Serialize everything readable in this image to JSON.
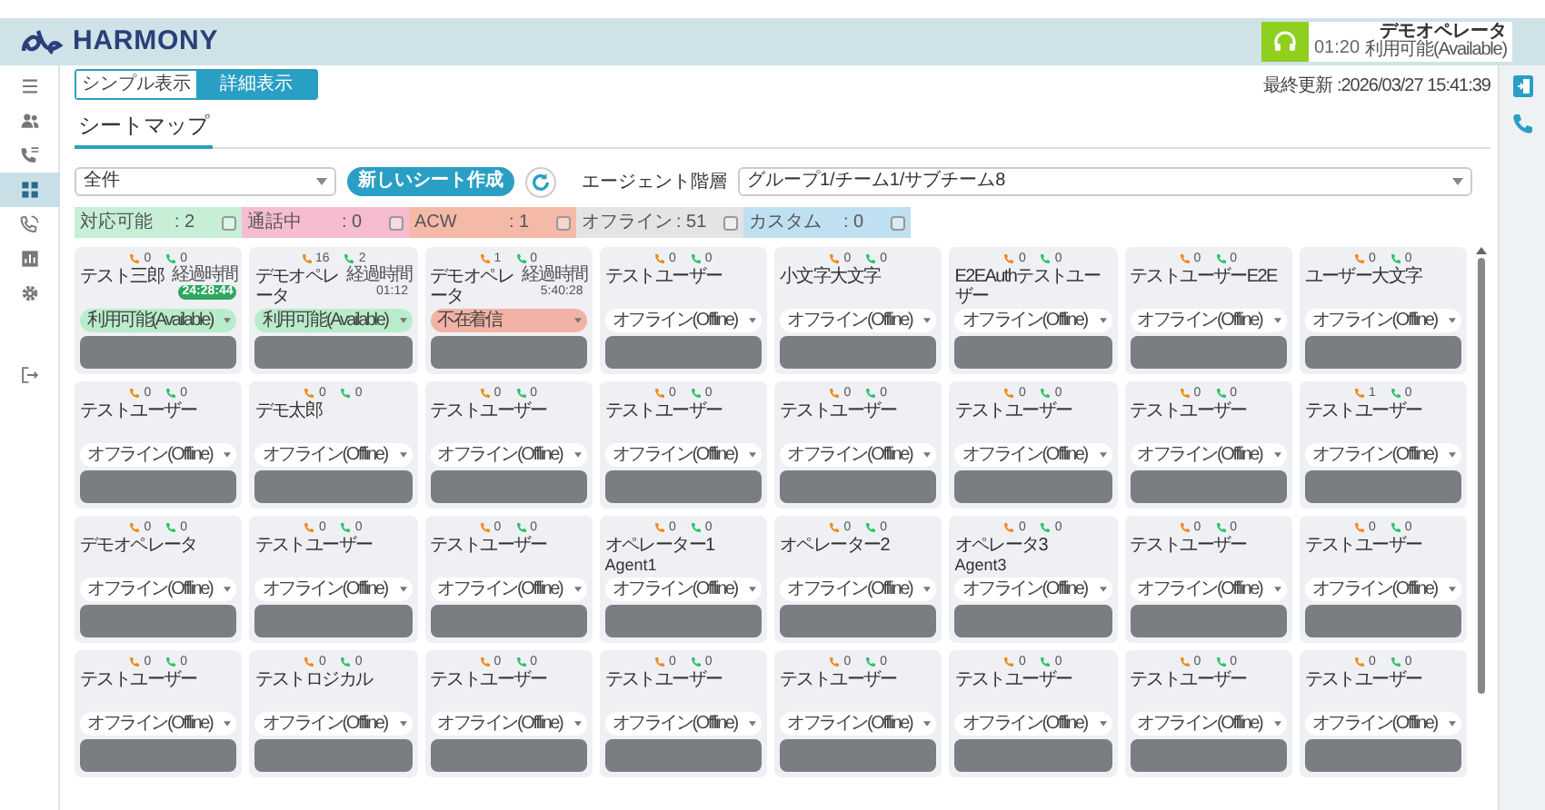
{
  "header": {
    "brand": "HARMONY",
    "agent": {
      "name": "デモオペレータ",
      "time": "01:20",
      "status": "利用可能(Available)"
    }
  },
  "sidebar": {
    "items": [
      {
        "kind": "menu",
        "selected": false
      },
      {
        "kind": "people",
        "selected": false
      },
      {
        "kind": "calls",
        "selected": false
      },
      {
        "kind": "grid",
        "selected": true
      },
      {
        "kind": "phone",
        "selected": false
      },
      {
        "kind": "chart",
        "selected": false
      },
      {
        "kind": "gear",
        "selected": false
      },
      {
        "kind": "logout",
        "selected": false
      }
    ]
  },
  "view_toggle": [
    {
      "label": "シンプル表示",
      "selected": false
    },
    {
      "label": "詳細表示",
      "selected": true
    }
  ],
  "last_updated": "最終更新 :2026/03/27 15:41:39",
  "title": "シートマップ",
  "toolbar": {
    "sheet_select": "全件",
    "create_button": "新しいシート作成",
    "hierarchy_label": "エージェント階層",
    "hierarchy_select": "グループ1/チーム1/サブチーム8"
  },
  "filters": [
    {
      "label": "対応可能",
      "count": ": 2",
      "color": "#c6efd6",
      "checked": false
    },
    {
      "label": "通話中",
      "count": ": 0",
      "color": "#f6bdd0",
      "checked": false
    },
    {
      "label": "ACW",
      "count": ": 1",
      "color": "#f5b9a8",
      "checked": false
    },
    {
      "label": "オフライン",
      "count": ": 51",
      "color": "#e4e4e4",
      "checked": false
    },
    {
      "label": "カスタム",
      "count": ": 0",
      "color": "#bfe0f0",
      "checked": false
    }
  ],
  "seats": [
    {
      "name": "テスト三郎",
      "incoming": "0",
      "outgoing": "0",
      "elapsed": {
        "label": "経過時間",
        "time": "24:28:44",
        "highlight": true
      },
      "status": "利用可能(Available)",
      "kind": "available"
    },
    {
      "name": "デモオペレータ",
      "incoming": "16",
      "outgoing": "2",
      "elapsed": {
        "label": "経過時間",
        "time": "01:12",
        "highlight": false
      },
      "status": "利用可能(Available)",
      "kind": "available"
    },
    {
      "name": "デモオペレータ",
      "incoming": "1",
      "outgoing": "0",
      "elapsed": {
        "label": "経過時間",
        "time": "5:40:28",
        "highlight": false
      },
      "status": "不在着信",
      "kind": "missed"
    },
    {
      "name": "テストユーザー",
      "incoming": "0",
      "outgoing": "0",
      "status": "オフライン(Offline)",
      "kind": "offline"
    },
    {
      "name": "小文字大文字",
      "incoming": "0",
      "outgoing": "0",
      "status": "オフライン(Offline)",
      "kind": "offline"
    },
    {
      "name": "E2EAuthテストユーザー",
      "incoming": "0",
      "outgoing": "0",
      "status": "オフライン(Offline)",
      "kind": "offline"
    },
    {
      "name": "テストユーザーE2E",
      "incoming": "0",
      "outgoing": "0",
      "status": "オフライン(Offline)",
      "kind": "offline"
    },
    {
      "name": "ユーザー大文字",
      "incoming": "0",
      "outgoing": "0",
      "status": "オフライン(Offline)",
      "kind": "offline"
    },
    {
      "name": "テストユーザー",
      "incoming": "0",
      "outgoing": "0",
      "status": "オフライン(Offline)",
      "kind": "offline"
    },
    {
      "name": "デモ太郎",
      "incoming": "0",
      "outgoing": "0",
      "status": "オフライン(Offline)",
      "kind": "offline"
    },
    {
      "name": "テストユーザー",
      "incoming": "0",
      "outgoing": "0",
      "status": "オフライン(Offline)",
      "kind": "offline"
    },
    {
      "name": "テストユーザー",
      "incoming": "0",
      "outgoing": "0",
      "status": "オフライン(Offline)",
      "kind": "offline"
    },
    {
      "name": "テストユーザー",
      "incoming": "0",
      "outgoing": "0",
      "status": "オフライン(Offline)",
      "kind": "offline"
    },
    {
      "name": "テストユーザー",
      "incoming": "0",
      "outgoing": "0",
      "status": "オフライン(Offline)",
      "kind": "offline"
    },
    {
      "name": "テストユーザー",
      "incoming": "0",
      "outgoing": "0",
      "status": "オフライン(Offline)",
      "kind": "offline"
    },
    {
      "name": "テストユーザー",
      "incoming": "1",
      "outgoing": "0",
      "status": "オフライン(Offline)",
      "kind": "offline"
    },
    {
      "name": "デモオペレータ",
      "incoming": "0",
      "outgoing": "0",
      "status": "オフライン(Offline)",
      "kind": "offline"
    },
    {
      "name": "テストユーザー",
      "incoming": "0",
      "outgoing": "0",
      "status": "オフライン(Offline)",
      "kind": "offline"
    },
    {
      "name": "テストユーザー",
      "incoming": "0",
      "outgoing": "0",
      "status": "オフライン(Offline)",
      "kind": "offline"
    },
    {
      "name": "オペレーター1",
      "subname": "Agent1",
      "incoming": "0",
      "outgoing": "0",
      "status": "オフライン(Offline)",
      "kind": "offline"
    },
    {
      "name": "オペレーター2",
      "incoming": "0",
      "outgoing": "0",
      "status": "オフライン(Offline)",
      "kind": "offline"
    },
    {
      "name": "オペレータ3",
      "subname": "Agent3",
      "incoming": "0",
      "outgoing": "0",
      "status": "オフライン(Offline)",
      "kind": "offline"
    },
    {
      "name": "テストユーザー",
      "incoming": "0",
      "outgoing": "0",
      "status": "オフライン(Offline)",
      "kind": "offline"
    },
    {
      "name": "テストユーザー",
      "incoming": "0",
      "outgoing": "0",
      "status": "オフライン(Offline)",
      "kind": "offline"
    },
    {
      "name": "テストユーザー",
      "incoming": "0",
      "outgoing": "0",
      "status": "オフライン(Offline)",
      "kind": "offline"
    },
    {
      "name": "テストロジカル",
      "incoming": "0",
      "outgoing": "0",
      "status": "オフライン(Offline)",
      "kind": "offline"
    },
    {
      "name": "テストユーザー",
      "incoming": "0",
      "outgoing": "0",
      "status": "オフライン(Offline)",
      "kind": "offline"
    },
    {
      "name": "テストユーザー",
      "incoming": "0",
      "outgoing": "0",
      "status": "オフライン(Offline)",
      "kind": "offline"
    },
    {
      "name": "テストユーザー",
      "incoming": "0",
      "outgoing": "0",
      "status": "オフライン(Offline)",
      "kind": "offline"
    },
    {
      "name": "テストユーザー",
      "incoming": "0",
      "outgoing": "0",
      "status": "オフライン(Offline)",
      "kind": "offline"
    },
    {
      "name": "テストユーザー",
      "incoming": "0",
      "outgoing": "0",
      "status": "オフライン(Offline)",
      "kind": "offline"
    },
    {
      "name": "テストユーザー",
      "incoming": "0",
      "outgoing": "0",
      "status": "オフライン(Offline)",
      "kind": "offline"
    }
  ]
}
